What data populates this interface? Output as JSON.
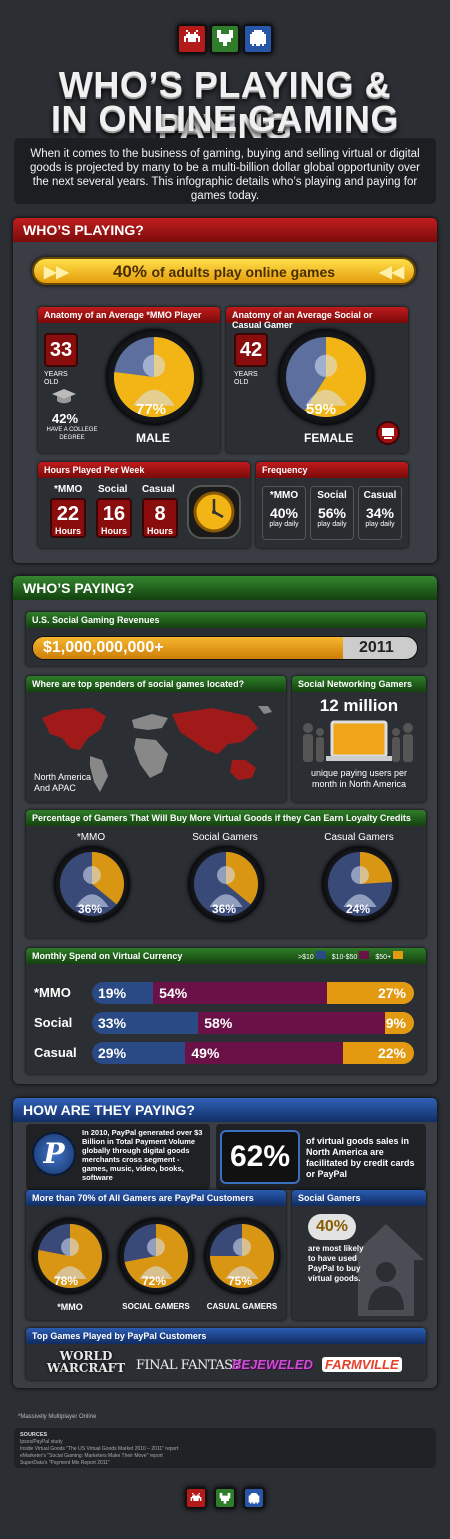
{
  "title": {
    "line1": "WHO’S PLAYING & PAYING",
    "line2": "IN ONLINE GAMING"
  },
  "intro": "When it comes to the business of gaming, buying and selling virtual or digital goods is projected by many to be a multi-billion dollar global opportunity over the next several years. This infographic details who’s playing and paying for games today.",
  "section1": {
    "banner": "WHO’S PLAYING?",
    "adults_value": "40%",
    "adults_text": "of adults play online games",
    "mmo": {
      "header": "Anatomy of an Average *MMO Player",
      "age": "33",
      "age_label": "YEARS OLD",
      "degree_pct": "42%",
      "degree_label": "HAVE A COLLEGE DEGREE",
      "gender_pct": "77%",
      "gender": "MALE"
    },
    "social": {
      "header": "Anatomy of an Average Social or Casual Gamer",
      "age": "42",
      "age_label": "YEARS OLD",
      "gender_pct": "59%",
      "gender": "FEMALE"
    },
    "hours": {
      "header": "Hours Played Per Week",
      "items": [
        {
          "label": "*MMO",
          "value": "22",
          "unit": "Hours"
        },
        {
          "label": "Social",
          "value": "16",
          "unit": "Hours"
        },
        {
          "label": "Casual",
          "value": "8",
          "unit": "Hours"
        }
      ]
    },
    "frequency": {
      "header": "Frequency",
      "items": [
        {
          "label": "*MMO",
          "value": "40%",
          "unit": "play daily"
        },
        {
          "label": "Social",
          "value": "56%",
          "unit": "play daily"
        },
        {
          "label": "Casual",
          "value": "34%",
          "unit": "play daily"
        }
      ]
    }
  },
  "section2": {
    "banner": "WHO’S PAYING?",
    "revenue": {
      "header": "U.S. Social Gaming Revenues",
      "value": "$1,000,000,000+",
      "year": "2011"
    },
    "spenders": {
      "header": "Where are top spenders of social games located?",
      "label": "North America And APAC"
    },
    "networking": {
      "header": "Social Networking Gamers",
      "value": "12 million",
      "text": "unique paying users per month in North America"
    },
    "loyalty": {
      "header": "Percentage of Gamers That Will Buy More Virtual Goods if they Can Earn Loyalty Credits",
      "items": [
        {
          "label": "*MMO",
          "value": "36%"
        },
        {
          "label": "Social Gamers",
          "value": "36%"
        },
        {
          "label": "Casual Gamers",
          "value": "24%"
        }
      ]
    },
    "monthly": {
      "header": "Monthly Spend on Virtual Currency",
      "legend": [
        ">$10",
        "$10-$50",
        "$50+"
      ]
    }
  },
  "section3": {
    "banner": "HOW ARE THEY PAYING?",
    "paypal_text": "In 2010, PayPal generated over $3 Billion in Total Payment Volume globally through digital goods merchants cross segment - games, music, video, books, software",
    "credit_value": "62%",
    "credit_text": "of virtual goods sales in North America are facilitated by credit cards or PayPal",
    "customers": {
      "header": "More than 70% of All Gamers are PayPal Customers",
      "items": [
        {
          "label": "*MMO",
          "value": "78%"
        },
        {
          "label": "SOCIAL GAMERS",
          "value": "72%"
        },
        {
          "label": "CASUAL GAMERS",
          "value": "75%"
        }
      ]
    },
    "social_gamers": {
      "header": "Social Gamers",
      "value": "40%",
      "text": "are most likely to have used PayPal to buy virtual goods."
    },
    "top_games": {
      "header": "Top Games Played by PayPal Customers",
      "games": [
        "WORLD WARCRAFT",
        "FINAL FANTASY",
        "BEJEWELED",
        "FARMVILLE"
      ]
    }
  },
  "footnote": "*Massively Multiplayer Online",
  "sources": {
    "title": "SOURCES",
    "items": [
      "Ipsos/PayPal study",
      "Inside Virtual Goods \"The US Virtual Goods Market 2010 – 2011\" report",
      "eMarketer's \"Social Gaming: Marketers Make Their Move\" report",
      "SuperData's \"Payment Mix Report 2011\""
    ]
  },
  "colors": {
    "red": "#c11d1d",
    "green": "#34852e",
    "blue": "#2f61b8",
    "orange": "#e39a10",
    "purple": "#6a1248",
    "navy": "#2a4a86"
  },
  "chart_data": [
    {
      "type": "pie",
      "title": "Anatomy of an Average *MMO Player",
      "slices": [
        {
          "label": "MALE",
          "value": 77
        },
        {
          "label": "",
          "value": 23
        }
      ]
    },
    {
      "type": "pie",
      "title": "Anatomy of an Average Social or Casual Gamer",
      "slices": [
        {
          "label": "FEMALE",
          "value": 59
        },
        {
          "label": "",
          "value": 41
        }
      ]
    },
    {
      "type": "bar",
      "title": "Monthly Spend on Virtual Currency",
      "categories": [
        "*MMO",
        "Social",
        "Casual"
      ],
      "series": [
        {
          "name": ">$10",
          "values": [
            19,
            33,
            29
          ]
        },
        {
          "name": "$10-$50",
          "values": [
            54,
            58,
            49
          ]
        },
        {
          "name": "$50+",
          "values": [
            27,
            9,
            22
          ]
        }
      ]
    }
  ]
}
